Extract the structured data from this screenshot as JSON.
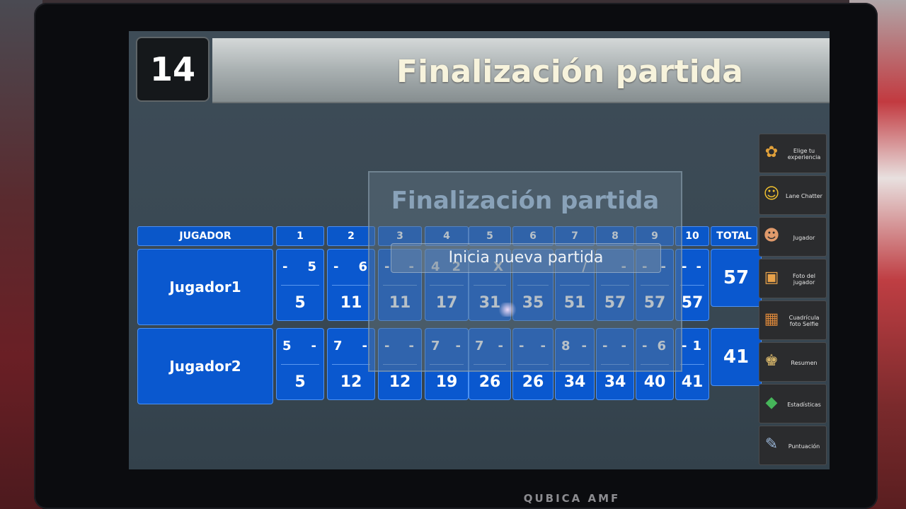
{
  "lane_number": "14",
  "title": "Finalización partida",
  "dialog": {
    "title": "Finalización partida",
    "button": "Inicia nueva partida"
  },
  "headers": {
    "player": "JUGADOR",
    "frames": [
      "1",
      "2",
      "3",
      "4",
      "5",
      "6",
      "7",
      "8",
      "9",
      "10"
    ],
    "total": "TOTAL"
  },
  "players": [
    {
      "name": "Jugador1",
      "frames": [
        {
          "b1": "-",
          "b2": "5",
          "cum": "5"
        },
        {
          "b1": "-",
          "b2": "6",
          "cum": "11"
        },
        {
          "b1": "-",
          "b2": "-",
          "cum": "11"
        },
        {
          "b1": "4",
          "b2": "2",
          "cum": "17"
        },
        {
          "b1": "",
          "b2": "X",
          "cum": "31"
        },
        {
          "b1": "",
          "b2": "",
          "cum": "35"
        },
        {
          "b1": "",
          "b2": "/",
          "cum": "51"
        },
        {
          "b1": "",
          "b2": "-",
          "cum": "57"
        },
        {
          "b1": "-",
          "b2": "-",
          "cum": "57"
        },
        {
          "b1": "-",
          "b2": "-",
          "cum": "57"
        }
      ],
      "total": "57"
    },
    {
      "name": "Jugador2",
      "frames": [
        {
          "b1": "5",
          "b2": "-",
          "cum": "5"
        },
        {
          "b1": "7",
          "b2": "-",
          "cum": "12"
        },
        {
          "b1": "-",
          "b2": "-",
          "cum": "12"
        },
        {
          "b1": "7",
          "b2": "-",
          "cum": "19"
        },
        {
          "b1": "7",
          "b2": "-",
          "cum": "26"
        },
        {
          "b1": "-",
          "b2": "-",
          "cum": "26"
        },
        {
          "b1": "8",
          "b2": "-",
          "cum": "34"
        },
        {
          "b1": "-",
          "b2": "-",
          "cum": "34"
        },
        {
          "b1": "-",
          "b2": "6",
          "cum": "40"
        },
        {
          "b1": "-",
          "b2": "1",
          "cum": "41"
        }
      ],
      "total": "41"
    }
  ],
  "side_menu": [
    {
      "label": "Elige tu experiencia",
      "icon": "apps-icon"
    },
    {
      "label": "Lane Chatter",
      "icon": "smiley-chat-icon"
    },
    {
      "label": "Jugador",
      "icon": "players-icon"
    },
    {
      "label": "Foto del jugador",
      "icon": "photo-icon"
    },
    {
      "label": "Cuadrícula foto Selfie",
      "icon": "selfie-grid-icon"
    },
    {
      "label": "Resumen",
      "icon": "summary-icon"
    },
    {
      "label": "Estadísticas",
      "icon": "stats-cube-icon"
    },
    {
      "label": "Puntuación",
      "icon": "score-icon"
    }
  ],
  "brand": "QUBICA AMF"
}
